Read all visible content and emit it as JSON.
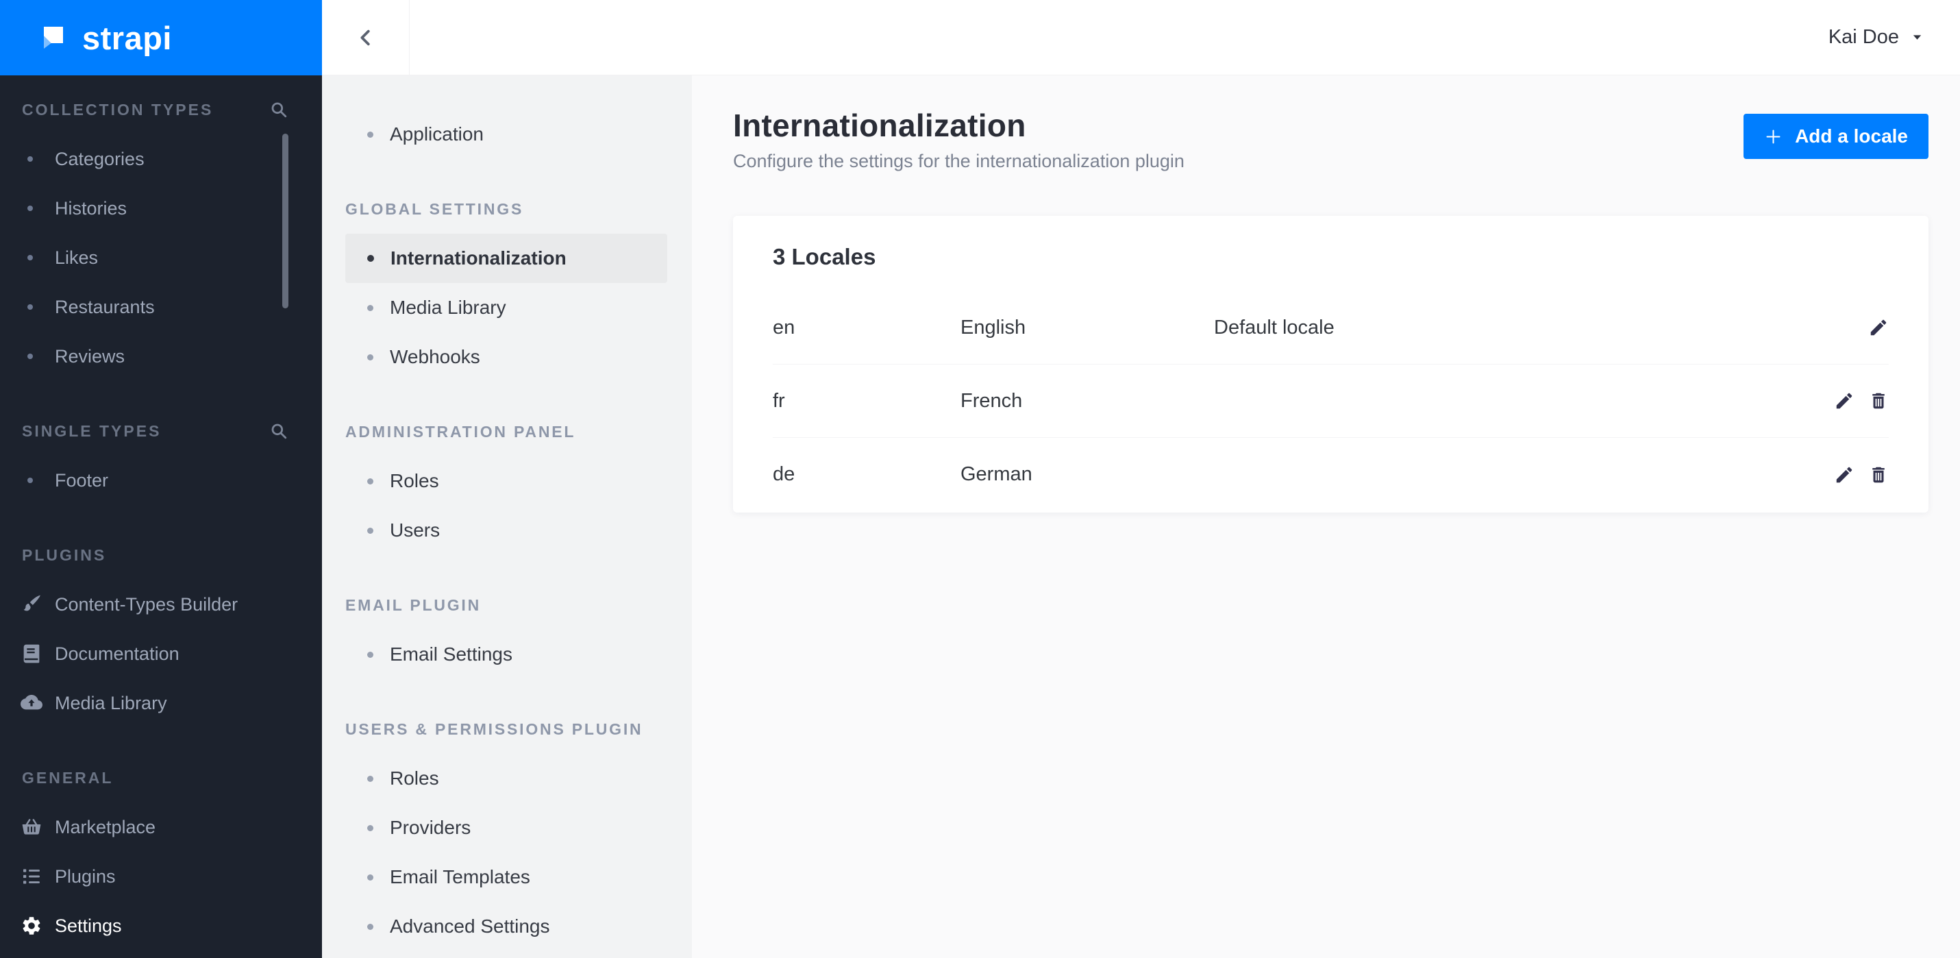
{
  "brand": {
    "name": "strapi",
    "accent_color": "#007eff",
    "sidebar_color": "#1c222d"
  },
  "header": {
    "user_name": "Kai Doe"
  },
  "sidebar": {
    "sections": [
      {
        "label": "COLLECTION TYPES",
        "has_search": true,
        "items": [
          {
            "label": "Categories"
          },
          {
            "label": "Histories"
          },
          {
            "label": "Likes"
          },
          {
            "label": "Restaurants"
          },
          {
            "label": "Reviews"
          }
        ]
      },
      {
        "label": "SINGLE TYPES",
        "has_search": true,
        "items": [
          {
            "label": "Footer"
          }
        ]
      },
      {
        "label": "PLUGINS",
        "items": [
          {
            "label": "Content-Types Builder",
            "icon": "paintbrush-icon"
          },
          {
            "label": "Documentation",
            "icon": "book-icon"
          },
          {
            "label": "Media Library",
            "icon": "cloud-upload-icon"
          }
        ]
      },
      {
        "label": "GENERAL",
        "items": [
          {
            "label": "Marketplace",
            "icon": "basket-icon"
          },
          {
            "label": "Plugins",
            "icon": "list-icon"
          },
          {
            "label": "Settings",
            "icon": "gear-icon",
            "active": true
          }
        ]
      }
    ]
  },
  "settings_nav": {
    "top_items": [
      {
        "label": "Application"
      }
    ],
    "sections": [
      {
        "label": "GLOBAL SETTINGS",
        "items": [
          {
            "label": "Internationalization",
            "active": true
          },
          {
            "label": "Media Library"
          },
          {
            "label": "Webhooks"
          }
        ]
      },
      {
        "label": "ADMINISTRATION PANEL",
        "items": [
          {
            "label": "Roles"
          },
          {
            "label": "Users"
          }
        ]
      },
      {
        "label": "EMAIL PLUGIN",
        "items": [
          {
            "label": "Email Settings"
          }
        ]
      },
      {
        "label": "USERS & PERMISSIONS PLUGIN",
        "items": [
          {
            "label": "Roles"
          },
          {
            "label": "Providers"
          },
          {
            "label": "Email Templates"
          },
          {
            "label": "Advanced Settings"
          }
        ]
      }
    ]
  },
  "main": {
    "title": "Internationalization",
    "subtitle": "Configure the settings for the internationalization plugin",
    "add_button_label": "Add a locale",
    "locales": {
      "heading": "3 Locales",
      "rows": [
        {
          "code": "en",
          "name": "English",
          "badge": "Default locale"
        },
        {
          "code": "fr",
          "name": "French",
          "badge": ""
        },
        {
          "code": "de",
          "name": "German",
          "badge": ""
        }
      ]
    }
  }
}
